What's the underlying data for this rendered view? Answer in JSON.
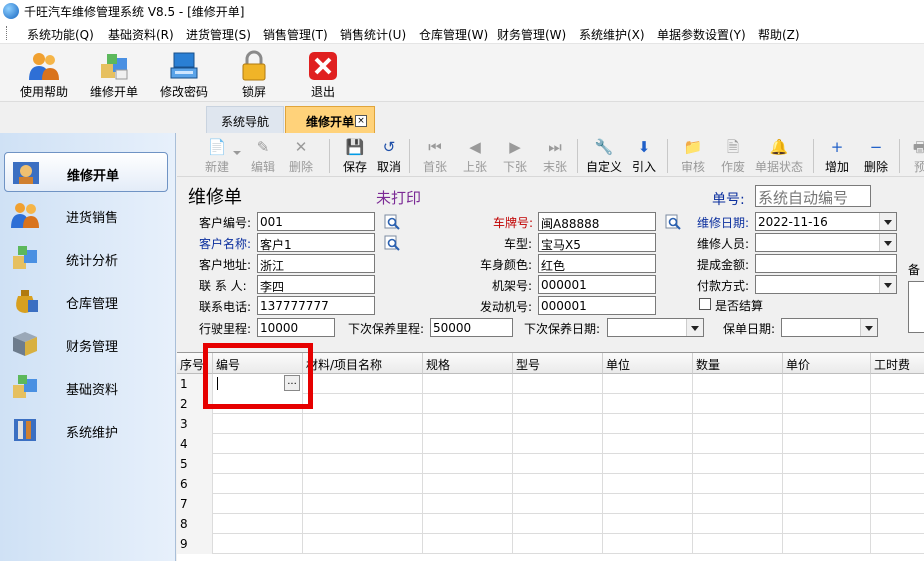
{
  "window": {
    "title": "千旺汽车维修管理系统 V8.5 - [维修开单]"
  },
  "menu": [
    "系统功能(Q)",
    "基础资料(R)",
    "进货管理(S)",
    "销售管理(T)",
    "销售统计(U)",
    "仓库管理(W)",
    "财务管理(W)",
    "系统维护(X)",
    "单据参数设置(Y)",
    "帮助(Z)"
  ],
  "main_toolbar": [
    "使用帮助",
    "维修开单",
    "修改密码",
    "锁屏",
    "退出"
  ],
  "tabs": {
    "nav": "系统导航",
    "active": "维修开单",
    "close_glyph": "×"
  },
  "sidebar": [
    "维修开单",
    "进货销售",
    "统计分析",
    "仓库管理",
    "财务管理",
    "基础资料",
    "系统维护"
  ],
  "toolbar": [
    {
      "label": "新建",
      "icon": "📄",
      "enabled": false
    },
    {
      "label": "编辑",
      "icon": "✎",
      "enabled": false
    },
    {
      "label": "删除",
      "icon": "✕",
      "enabled": false
    },
    {
      "label": "保存",
      "icon": "💾",
      "enabled": true
    },
    {
      "label": "取消",
      "icon": "↺",
      "enabled": true
    },
    {
      "label": "首张",
      "icon": "⏮",
      "enabled": false
    },
    {
      "label": "上张",
      "icon": "◀",
      "enabled": false
    },
    {
      "label": "下张",
      "icon": "▶",
      "enabled": false
    },
    {
      "label": "末张",
      "icon": "⏭",
      "enabled": false
    },
    {
      "label": "自定义",
      "icon": "🔧",
      "enabled": true
    },
    {
      "label": "引入",
      "icon": "⬇",
      "enabled": true
    },
    {
      "label": "审核",
      "icon": "📁",
      "enabled": false
    },
    {
      "label": "作废",
      "icon": "🗎",
      "enabled": false
    },
    {
      "label": "单据状态",
      "icon": "🔔",
      "enabled": false
    },
    {
      "label": "增加",
      "icon": "+",
      "enabled": true
    },
    {
      "label": "删除",
      "icon": "−",
      "enabled": true
    },
    {
      "label": "预",
      "icon": "🖶",
      "enabled": false
    }
  ],
  "form": {
    "title": "维修单",
    "print_status": "未打印",
    "doc_no_label": "单号:",
    "doc_no_value": "系统自动编号",
    "customer_code_label": "客户编号:",
    "customer_code": "001",
    "customer_name_label": "客户名称:",
    "customer_name": "客户1",
    "customer_addr_label": "客户地址:",
    "customer_addr": "浙江",
    "contact_label": "联 系 人:",
    "contact": "李四",
    "phone_label": "联系电话:",
    "phone": "137777777",
    "plate_label": "车牌号:",
    "plate": "闽A88888",
    "model_label": "车型:",
    "model": "宝马X5",
    "color_label": "车身颜色:",
    "color": "红色",
    "frame_label": "机架号:",
    "frame": "000001",
    "engine_label": "发动机号:",
    "engine": "000001",
    "repair_date_label": "维修日期:",
    "repair_date": "2022-11-16",
    "repairer_label": "维修人员:",
    "repairer": "",
    "commission_label": "提成金额:",
    "commission": "",
    "payment_label": "付款方式:",
    "payment": "",
    "settled_label": "是否结算",
    "mileage_label": "行驶里程:",
    "mileage": "10000",
    "next_mileage_label": "下次保养里程:",
    "next_mileage": "50000",
    "next_date_label": "下次保养日期:",
    "next_date": "",
    "warranty_label": "保单日期:",
    "warranty": "",
    "remark_label": "备"
  },
  "grid": {
    "columns": [
      "序号",
      "编号",
      "材料/项目名称",
      "规格",
      "型号",
      "单位",
      "数量",
      "单价",
      "工时费"
    ],
    "rows": [
      "1",
      "2",
      "3",
      "4",
      "5",
      "6",
      "7",
      "8",
      "9"
    ],
    "ellipsis": "..."
  },
  "colors": {
    "highlight": "#e60000",
    "active_tab": "#ffd27a",
    "label_blue": "#0b2f9e",
    "label_red": "#c00000"
  }
}
